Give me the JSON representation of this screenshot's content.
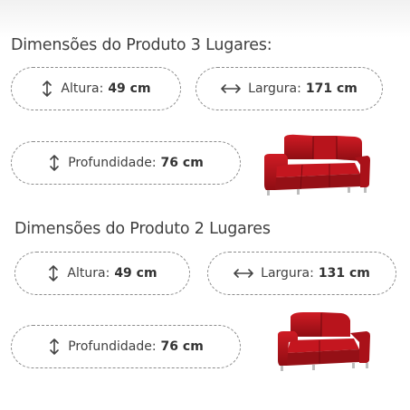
{
  "sections": [
    {
      "title": "Dimensões do Produto 3 Lugares:",
      "height": {
        "label": "Altura:",
        "value": "49 cm"
      },
      "width": {
        "label": "Largura:",
        "value": "171 cm"
      },
      "depth": {
        "label": "Profundidade:",
        "value": "76 cm"
      }
    },
    {
      "title": "Dimensões do Produto 2 Lugares",
      "height": {
        "label": "Altura:",
        "value": "49 cm"
      },
      "width": {
        "label": "Largura:",
        "value": "131 cm"
      },
      "depth": {
        "label": "Profundidade:",
        "value": "76 cm"
      }
    }
  ],
  "colors": {
    "sofa": "#b3121a",
    "sofa_dark": "#7e0a10",
    "border": "#8c8c8c",
    "text": "#404040"
  },
  "icons": [
    "vertical-arrow-icon",
    "horizontal-arrow-icon",
    "sofa-3-seat-image",
    "sofa-2-seat-image"
  ]
}
